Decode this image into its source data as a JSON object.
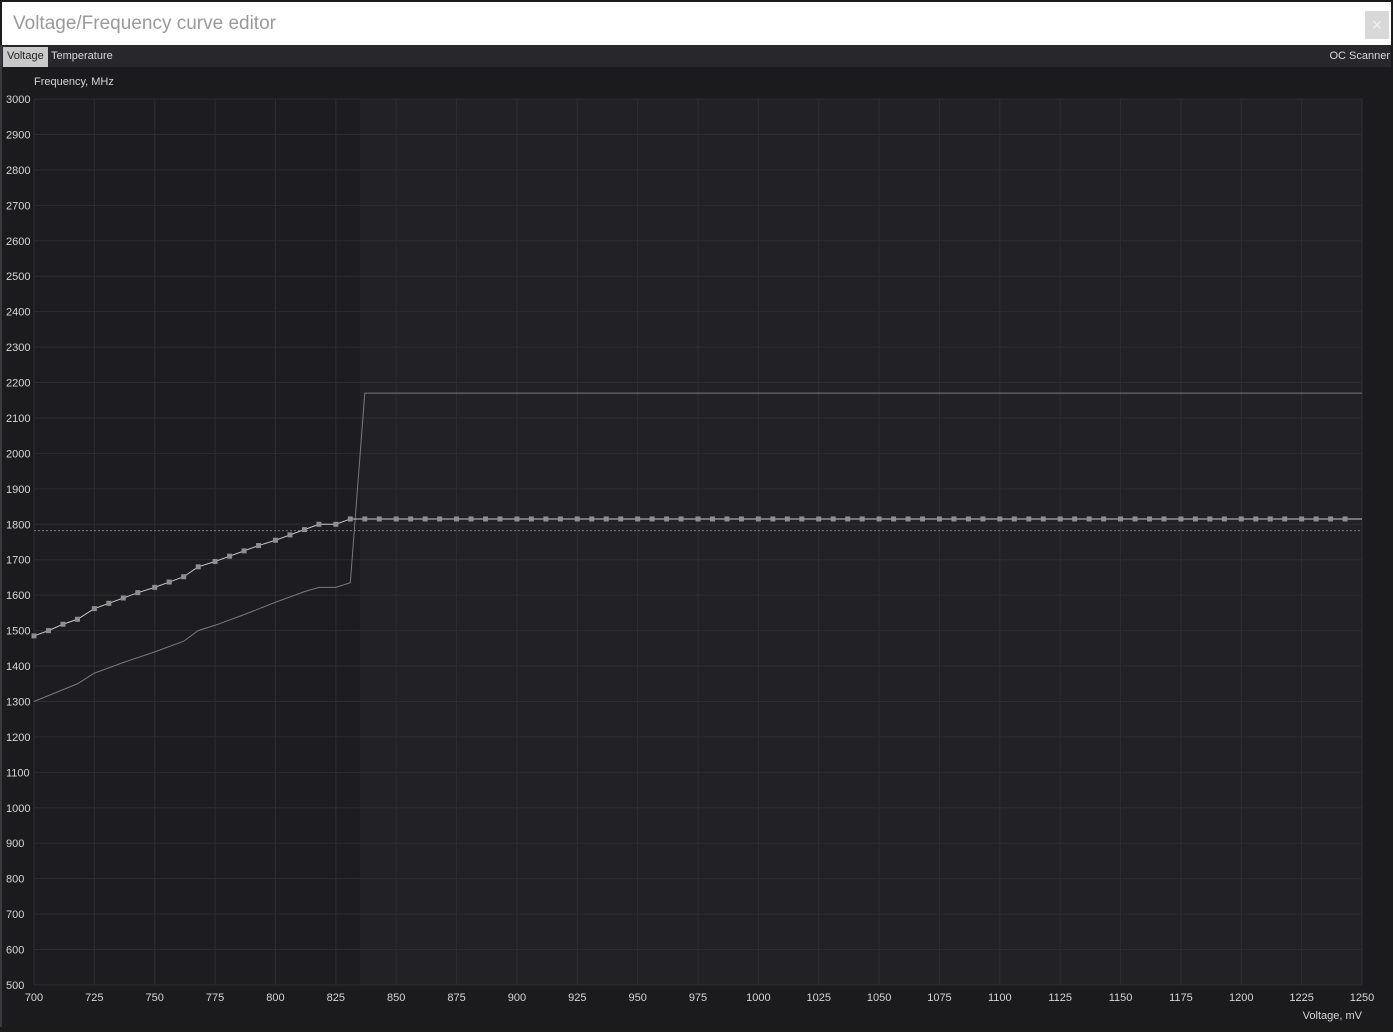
{
  "window": {
    "title": "Voltage/Frequency curve editor",
    "close_label": "×"
  },
  "tabs": [
    {
      "label": "Voltage",
      "active": true
    },
    {
      "label": "Temperature",
      "active": false
    }
  ],
  "oc_scanner_label": "OC Scanner",
  "colors": {
    "background": "#1b1b1e",
    "plot_left_region": "#1d1d21",
    "plot_right_region": "#222226",
    "grid": "#2d2d33",
    "curve": "#c8c8c8",
    "point": "#8f8f8f",
    "reference_line": "#7a7a7a",
    "tick_text": "#d6d6d6"
  },
  "chart_data": {
    "type": "line",
    "ylabel": "Frequency, MHz",
    "xlabel": "Voltage, mV",
    "xlim": [
      700,
      1250
    ],
    "ylim": [
      500,
      3000
    ],
    "x_ticks": [
      700,
      725,
      750,
      775,
      800,
      825,
      850,
      875,
      900,
      925,
      950,
      975,
      1000,
      1025,
      1050,
      1075,
      1100,
      1125,
      1150,
      1175,
      1200,
      1225,
      1250
    ],
    "y_ticks": [
      3000,
      2900,
      2800,
      2700,
      2600,
      2500,
      2400,
      2300,
      2200,
      2100,
      2000,
      1900,
      1800,
      1700,
      1600,
      1500,
      1400,
      1300,
      1200,
      1100,
      1000,
      900,
      800,
      700,
      600,
      500
    ],
    "grid": true,
    "highlight_region_from_mv": 835,
    "dotted_reference_mhz": 1782,
    "series": [
      {
        "role": "curve_points",
        "x": [
          700,
          706,
          712,
          718,
          725,
          731,
          737,
          743,
          750,
          756,
          762,
          768,
          775,
          781,
          787,
          793,
          800,
          806,
          812,
          818,
          825,
          831,
          837,
          843,
          850,
          856,
          862,
          868,
          875,
          881,
          887,
          893,
          900,
          906,
          912,
          918,
          925,
          931,
          937,
          943,
          950,
          956,
          962,
          968,
          975,
          981,
          987,
          993,
          1000,
          1006,
          1012,
          1018,
          1025,
          1031,
          1037,
          1043,
          1050,
          1056,
          1062,
          1068,
          1075,
          1081,
          1087,
          1093,
          1100,
          1106,
          1112,
          1118,
          1125,
          1131,
          1137,
          1143,
          1150,
          1156,
          1162,
          1168,
          1175,
          1181,
          1187,
          1193,
          1200,
          1206,
          1212,
          1218,
          1225,
          1231,
          1237,
          1243
        ],
        "y": [
          1485,
          1500,
          1518,
          1532,
          1562,
          1577,
          1592,
          1607,
          1622,
          1637,
          1652,
          1680,
          1695,
          1710,
          1725,
          1740,
          1755,
          1770,
          1785,
          1800,
          1800,
          1815,
          1815,
          1815,
          1815,
          1815,
          1815,
          1815,
          1815,
          1815,
          1815,
          1815,
          1815,
          1815,
          1815,
          1815,
          1815,
          1815,
          1815,
          1815,
          1815,
          1815,
          1815,
          1815,
          1815,
          1815,
          1815,
          1815,
          1815,
          1815,
          1815,
          1815,
          1815,
          1815,
          1815,
          1815,
          1815,
          1815,
          1815,
          1815,
          1815,
          1815,
          1815,
          1815,
          1815,
          1815,
          1815,
          1815,
          1815,
          1815,
          1815,
          1815,
          1815,
          1815,
          1815,
          1815,
          1815,
          1815,
          1815,
          1815,
          1815,
          1815,
          1815,
          1815,
          1815,
          1815,
          1815,
          1815
        ]
      },
      {
        "role": "default_curve",
        "x": [
          700,
          718,
          725,
          737,
          750,
          762,
          768,
          775,
          787,
          800,
          812,
          818,
          825,
          831,
          837,
          1250
        ],
        "y": [
          1300,
          1350,
          1380,
          1410,
          1440,
          1470,
          1500,
          1515,
          1545,
          1580,
          1610,
          1622,
          1622,
          1635,
          2170,
          2170
        ]
      }
    ]
  }
}
